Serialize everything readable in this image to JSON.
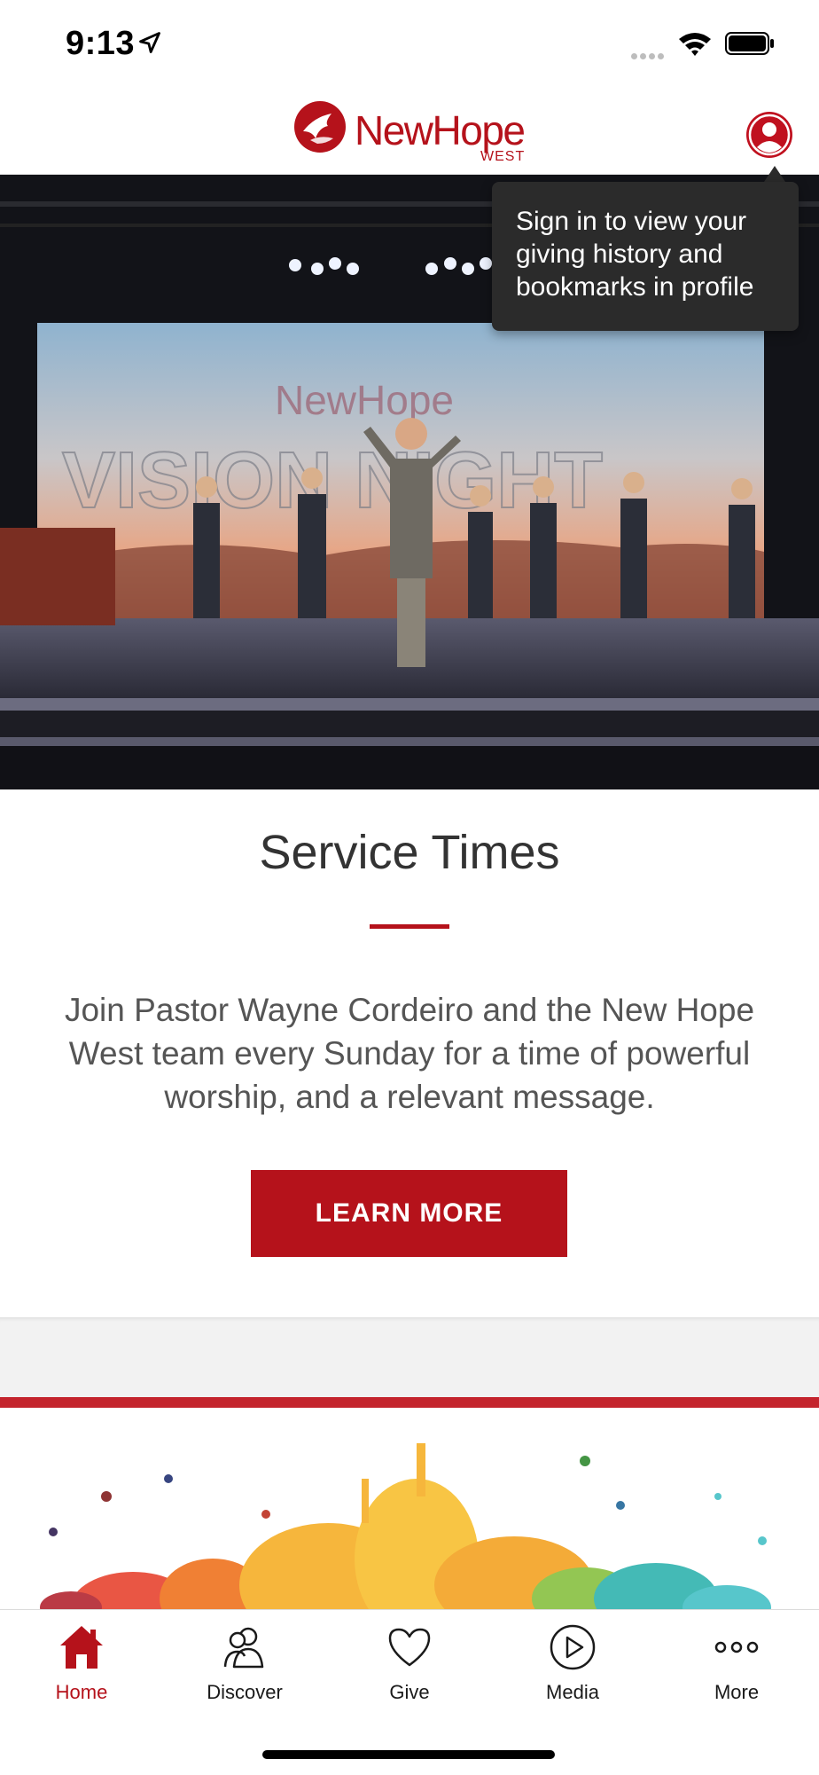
{
  "status_bar": {
    "time": "9:13"
  },
  "header": {
    "logo_text": "NewHope",
    "logo_sub": "WEST"
  },
  "tooltip": {
    "text": "Sign in to view your giving history and bookmarks in profile"
  },
  "service_times": {
    "title": "Service Times",
    "body": "Join Pastor Wayne Cordeiro and the New Hope West team every Sunday for a time of powerful worship, and a relevant message.",
    "button_label": "LEARN MORE"
  },
  "tabs": [
    {
      "label": "Home",
      "icon": "home-icon",
      "active": true
    },
    {
      "label": "Discover",
      "icon": "people-icon",
      "active": false
    },
    {
      "label": "Give",
      "icon": "heart-icon",
      "active": false
    },
    {
      "label": "Media",
      "icon": "play-icon",
      "active": false
    },
    {
      "label": "More",
      "icon": "more-icon",
      "active": false
    }
  ],
  "colors": {
    "brand_red": "#b5121b",
    "tooltip_bg": "#2b2b2b"
  }
}
